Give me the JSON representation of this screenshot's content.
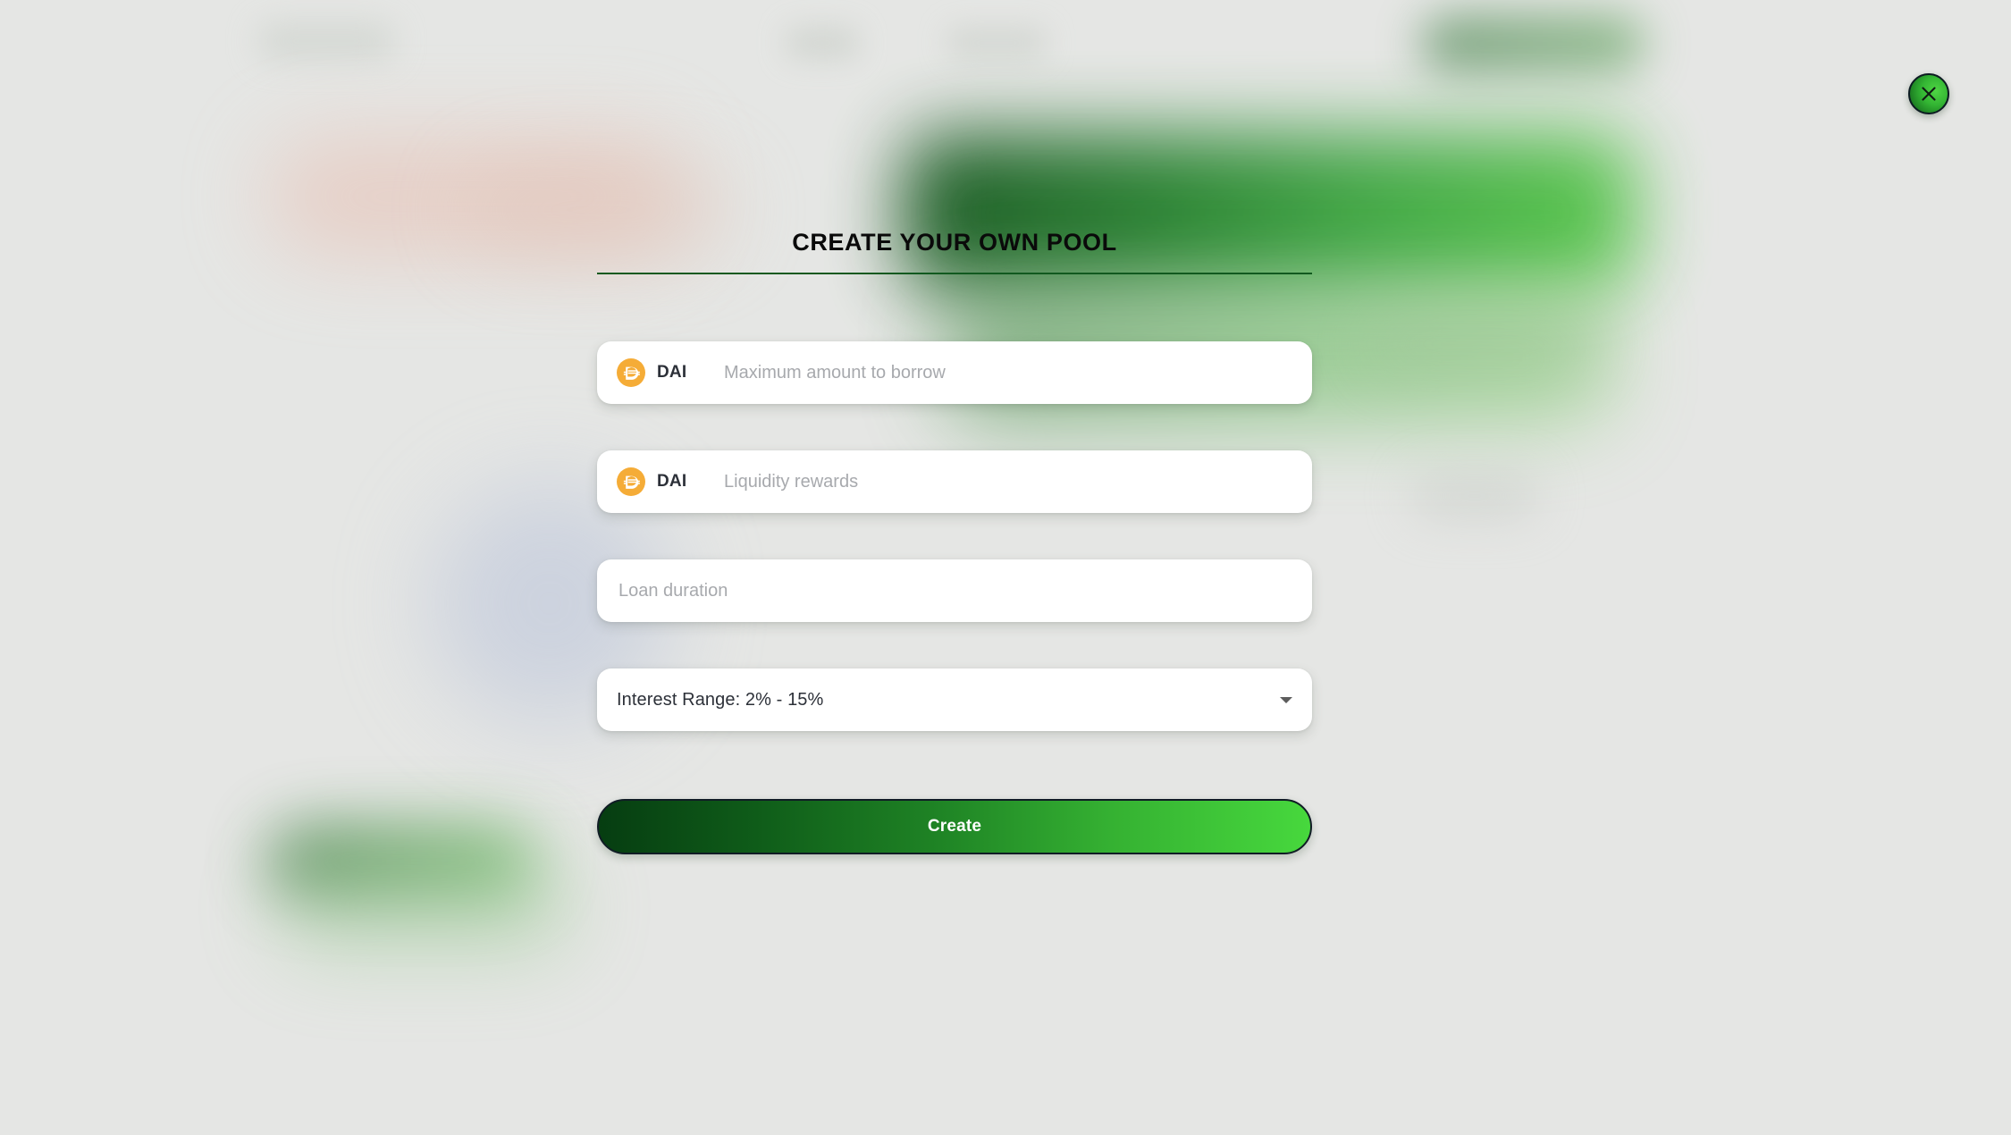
{
  "dialog": {
    "title": "CREATE YOUR OWN POOL",
    "close_label": "close-icon"
  },
  "fields": [
    {
      "name": "max-borrow",
      "token": "DAI",
      "token_icon": "dai-coin-icon",
      "value": "",
      "placeholder": "Maximum amount to borrow",
      "has_token": true
    },
    {
      "name": "liquidity-rewards",
      "token": "DAI",
      "token_icon": "dai-coin-icon",
      "value": "",
      "placeholder": "Liquidity rewards",
      "has_token": true
    },
    {
      "name": "loan-duration",
      "token": "",
      "token_icon": "",
      "value": "",
      "placeholder": "Loan duration",
      "has_token": false
    }
  ],
  "interest_select": {
    "label": "Interest Range: 2% - 15%",
    "caret_icon": "chevron-down-icon"
  },
  "submit": {
    "label": "Create"
  },
  "colors": {
    "page_background": "#e5e6e4",
    "card_background": "#ffffff",
    "title_text": "#0a0a0a",
    "title_rule": "#11591f",
    "placeholder_text": "#a7a9ad",
    "value_text": "#2c3038",
    "dai_accent": "#f5ac37",
    "button_gradient_start": "#063d11",
    "button_gradient_end": "#47d83d",
    "button_border": "#101c25",
    "caret": "#5c5c5c"
  }
}
